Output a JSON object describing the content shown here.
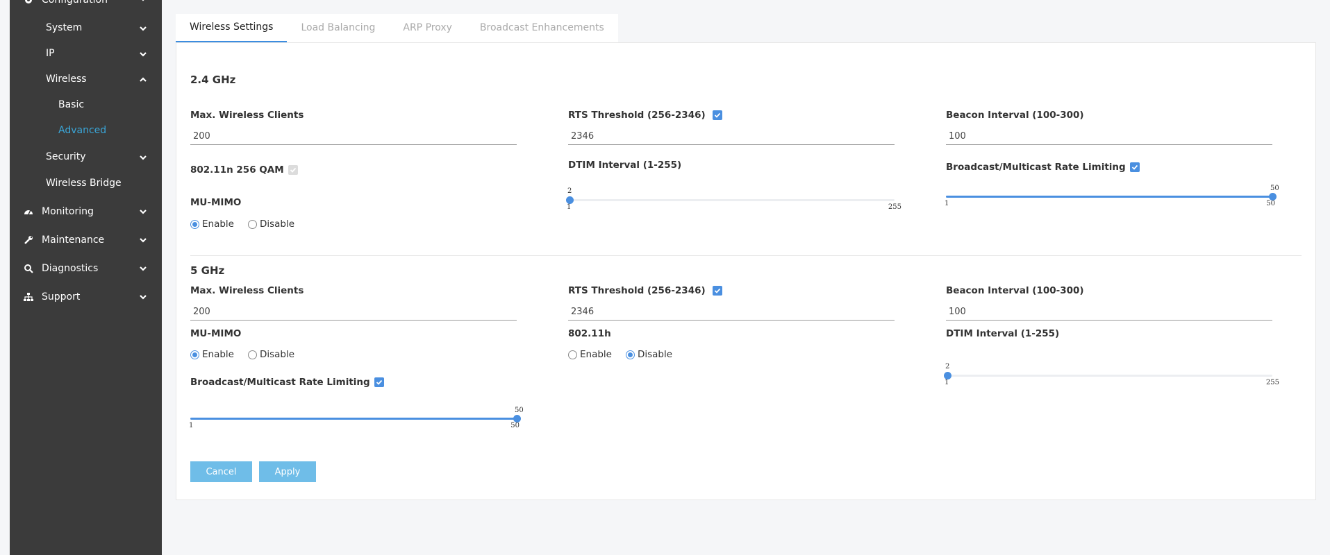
{
  "sidebar": {
    "configuration": "Configuration",
    "system": "System",
    "ip": "IP",
    "wireless": "Wireless",
    "basic": "Basic",
    "advanced": "Advanced",
    "security": "Security",
    "wireless_bridge": "Wireless Bridge",
    "monitoring": "Monitoring",
    "maintenance": "Maintenance",
    "diagnostics": "Diagnostics",
    "support": "Support"
  },
  "tabs": [
    "Wireless Settings",
    "Load Balancing",
    "ARP Proxy",
    "Broadcast Enhancements"
  ],
  "ghz24": {
    "title": "2.4 GHz",
    "max_clients_label": "Max. Wireless Clients",
    "max_clients_value": "200",
    "rts_label": "RTS Threshold (256-2346)",
    "rts_value": "2346",
    "beacon_label": "Beacon Interval (100-300)",
    "beacon_value": "100",
    "qam_label": "802.11n 256 QAM",
    "dtim_label": "DTIM Interval (1-255)",
    "dtim": {
      "min": 1,
      "max": 255,
      "value": 2,
      "min_label": "1",
      "max_label": "255",
      "value_label": "2"
    },
    "rate_label": "Broadcast/Multicast Rate Limiting",
    "rate": {
      "min": 1,
      "max": 50,
      "value": 50,
      "min_label": "1",
      "max_label": "50",
      "value_label": "50"
    },
    "mumimo_label": "MU-MIMO",
    "enable": "Enable",
    "disable": "Disable"
  },
  "ghz5": {
    "title": "5 GHz",
    "max_clients_label": "Max. Wireless Clients",
    "max_clients_value": "200",
    "rts_label": "RTS Threshold (256-2346)",
    "rts_value": "2346",
    "beacon_label": "Beacon Interval (100-300)",
    "beacon_value": "100",
    "mumimo_label": "MU-MIMO",
    "h_label": "802.11h",
    "dtim_label": "DTIM Interval (1-255)",
    "dtim": {
      "min": 1,
      "max": 255,
      "value": 2,
      "min_label": "1",
      "max_label": "255",
      "value_label": "2"
    },
    "rate_label": "Broadcast/Multicast Rate Limiting",
    "rate": {
      "min": 1,
      "max": 50,
      "value": 50,
      "min_label": "1",
      "max_label": "50",
      "value_label": "50"
    },
    "enable": "Enable",
    "disable": "Disable"
  },
  "buttons": {
    "cancel": "Cancel",
    "apply": "Apply"
  },
  "colors": {
    "accent": "#4a8fe0",
    "sidebar_bg": "#3b3b3b",
    "active_link": "#3aa6d8",
    "button": "#6fbde8"
  }
}
